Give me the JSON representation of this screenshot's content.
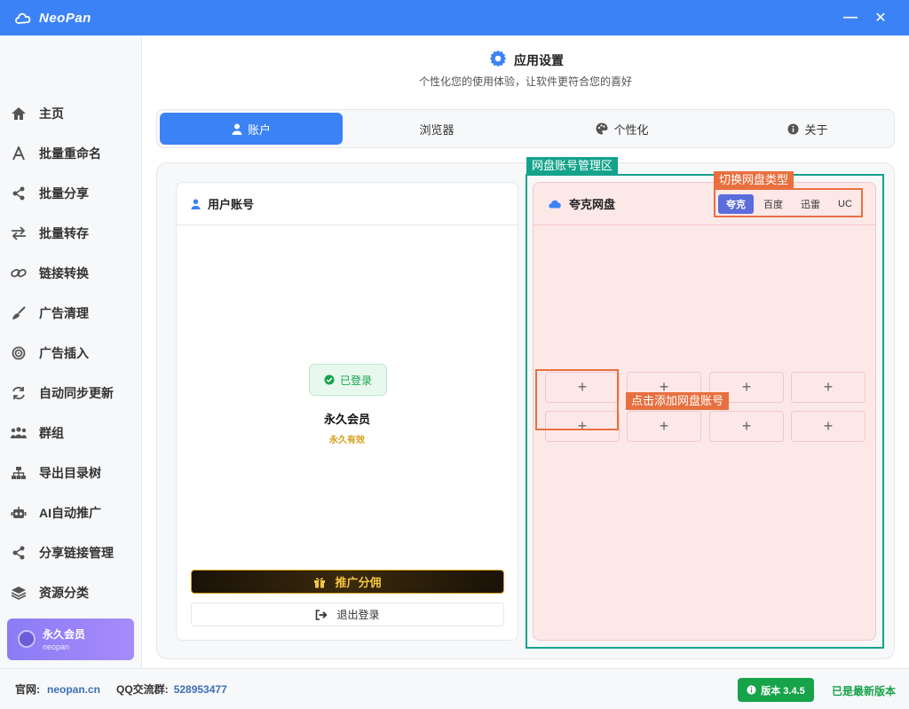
{
  "app": {
    "title": "NeoPan"
  },
  "window_controls": {
    "minimize": "—",
    "close": "✕"
  },
  "sidebar": {
    "items": [
      {
        "label": "主页",
        "icon": "home-icon"
      },
      {
        "label": "批量重命名",
        "icon": "letter-a-icon"
      },
      {
        "label": "批量分享",
        "icon": "share-icon"
      },
      {
        "label": "批量转存",
        "icon": "transfer-icon"
      },
      {
        "label": "链接转换",
        "icon": "link-icon"
      },
      {
        "label": "广告清理",
        "icon": "broom-icon"
      },
      {
        "label": "广告插入",
        "icon": "target-icon"
      },
      {
        "label": "自动同步更新",
        "icon": "sync-icon"
      },
      {
        "label": "群组",
        "icon": "group-icon"
      },
      {
        "label": "导出目录树",
        "icon": "tree-icon"
      },
      {
        "label": "AI自动推广",
        "icon": "robot-icon"
      },
      {
        "label": "分享链接管理",
        "icon": "share-icon"
      },
      {
        "label": "资源分类",
        "icon": "layers-icon"
      }
    ],
    "member": {
      "title": "永久会员",
      "subtitle": "neopan"
    }
  },
  "header": {
    "title": "应用设置",
    "subtitle": "个性化您的使用体验，让软件更符合您的喜好"
  },
  "tabs": [
    {
      "label": "账户",
      "icon": "user-icon"
    },
    {
      "label": "浏览器",
      "icon": ""
    },
    {
      "label": "个性化",
      "icon": "palette-icon"
    },
    {
      "label": "关于",
      "icon": "info-icon"
    }
  ],
  "user_card": {
    "title": "用户账号",
    "status": "已登录",
    "membership": "永久会员",
    "validity": "永久有效",
    "promo_button": "推广分佣",
    "logout_button": "退出登录"
  },
  "disk_card": {
    "title": "夸克网盘",
    "types": [
      "夸克",
      "百度",
      "迅雷",
      "UC"
    ],
    "add_symbol": "+"
  },
  "annotations": {
    "area": "网盘账号管理区",
    "switch": "切换网盘类型",
    "add": "点击添加网盘账号"
  },
  "footer": {
    "site_label": "官网:",
    "site_value": "neopan.cn",
    "qq_label": "QQ交流群:",
    "qq_value": "528953477",
    "version": "版本 3.4.5",
    "latest": "已是最新版本"
  },
  "colors": {
    "primary": "#3b82f6",
    "success": "#16a34a",
    "annotation": "#e87040",
    "annotation_green": "#14a38b"
  }
}
